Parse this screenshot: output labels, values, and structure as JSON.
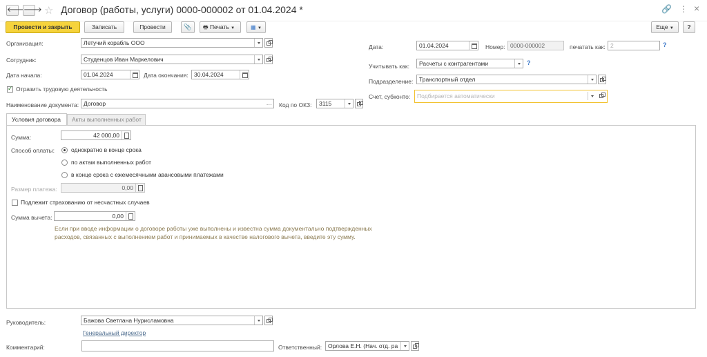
{
  "title": "Договор (работы, услуги) 0000-000002 от 01.04.2024 *",
  "toolbar": {
    "post_close": "Провести и закрыть",
    "save": "Записать",
    "post": "Провести",
    "print": "Печать",
    "more": "Еще"
  },
  "form": {
    "org_label": "Организация:",
    "org_value": "Летучий корабль ООО",
    "employee_label": "Сотрудник:",
    "employee_value": "Студенцов Иван Маркелович",
    "start_label": "Дата начала:",
    "start_value": "01.04.2024",
    "end_label": "Дата окончания:",
    "end_value": "30.04.2024",
    "reflect_label": "Отразить трудовую деятельность",
    "docname_label": "Наименование документа:",
    "docname_value": "Договор",
    "okz_label": "Код по ОКЗ:",
    "okz_value": "3115",
    "date_label": "Дата:",
    "date_value": "01.04.2024",
    "number_label": "Номер:",
    "number_value": "0000-000002",
    "printas_label": "печатать как:",
    "printas_value": "2",
    "account_as_label": "Учитывать как:",
    "account_as_value": "Расчеты с контрагентами",
    "dept_label": "Подразделение:",
    "dept_value": "Транспортный отдел",
    "subconto_label": "Счет, субконто:",
    "subconto_placeholder": "Подбирается автоматически",
    "help": "?"
  },
  "tabs": [
    {
      "label": "Условия договора"
    },
    {
      "label": "Акты выполненных работ"
    }
  ],
  "terms": {
    "sum_label": "Сумма:",
    "sum_value": "42 000,00",
    "payment_label": "Способ оплаты:",
    "pay_options": [
      "однократно в конце срока",
      "по актам выполненных работ",
      "в конце срока с ежемесячными авансовыми платежами"
    ],
    "payment_size_label": "Размер платежа:",
    "payment_size_value": "0,00",
    "insurance_label": "Подлежит страхованию от несчастных случаев",
    "deduction_label": "Сумма вычета:",
    "deduction_value": "0,00",
    "hint_line1": "Если при вводе информации о договоре работы уже выполнены и известна сумма документально подтвержденных",
    "hint_line2": "расходов, связанных с выполнением работ и принимаемых в качестве налогового вычета, введите эту сумму."
  },
  "footer": {
    "head_label": "Руководитель:",
    "head_value": "Бажова Светлана Нурисламовна",
    "head_position": "Генеральный директор",
    "comment_label": "Комментарий:",
    "responsible_label": "Ответственный:",
    "responsible_value": "Орлова Е.Н. (Нач. отд. ра"
  }
}
